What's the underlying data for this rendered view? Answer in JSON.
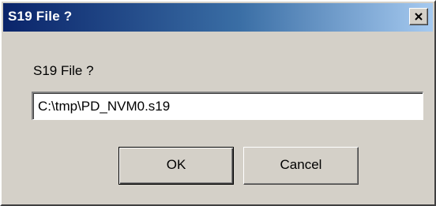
{
  "dialog": {
    "title": "S19 File ?",
    "prompt": "S19 File ?",
    "input_value": "C:\\tmp\\PD_NVM0.s19",
    "ok_label": "OK",
    "cancel_label": "Cancel",
    "close_icon": "close-icon"
  },
  "colors": {
    "titlebar_start": "#0a246a",
    "titlebar_end": "#a6caf0",
    "window_bg": "#d4d0c8"
  }
}
